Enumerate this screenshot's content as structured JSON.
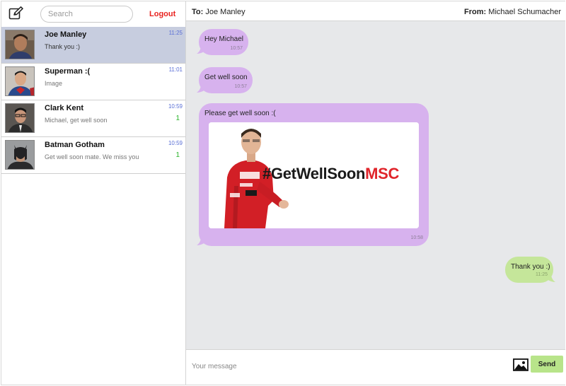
{
  "sidebar": {
    "search_placeholder": "Search",
    "logout_label": "Logout",
    "conversations": [
      {
        "name": "Joe Manley",
        "preview": "Thank you :)",
        "time": "11:25",
        "unread": "",
        "active": true,
        "avatar": "avatar-joe"
      },
      {
        "name": "Superman :(",
        "preview": "Image",
        "time": "11:01",
        "unread": "",
        "active": false,
        "avatar": "avatar-superman"
      },
      {
        "name": "Clark Kent",
        "preview": "Michael, get well soon",
        "time": "10:59",
        "unread": "1",
        "active": false,
        "avatar": "avatar-clark"
      },
      {
        "name": "Batman Gotham",
        "preview": "Get well soon mate. We miss you",
        "time": "10:59",
        "unread": "1",
        "active": false,
        "avatar": "avatar-batman"
      }
    ]
  },
  "header": {
    "to_label": "To:",
    "to_name": "Joe Manley",
    "from_label": "From:",
    "from_name": "Michael Schumacher"
  },
  "messages": [
    {
      "direction": "in",
      "text": "Hey Michael",
      "time": "10:57"
    },
    {
      "direction": "in",
      "text": "Get well soon",
      "time": "10:57"
    },
    {
      "direction": "in",
      "text": "Please get well soon :(",
      "time": "10:58",
      "image_caption_part1": "#GetWellSoon",
      "image_caption_part2": "MSC"
    },
    {
      "direction": "out",
      "text": "Thank you :)",
      "time": "11:25"
    }
  ],
  "composer": {
    "placeholder": "Your message",
    "send_label": "Send"
  },
  "colors": {
    "incoming_bubble": "#d7b2ee",
    "outgoing_bubble": "#c5e69a",
    "active_conversation": "#c7cddf",
    "logout": "#e8221f",
    "time": "#5a6fd6",
    "unread": "#2cb52c",
    "send_button": "#b8e48a"
  }
}
